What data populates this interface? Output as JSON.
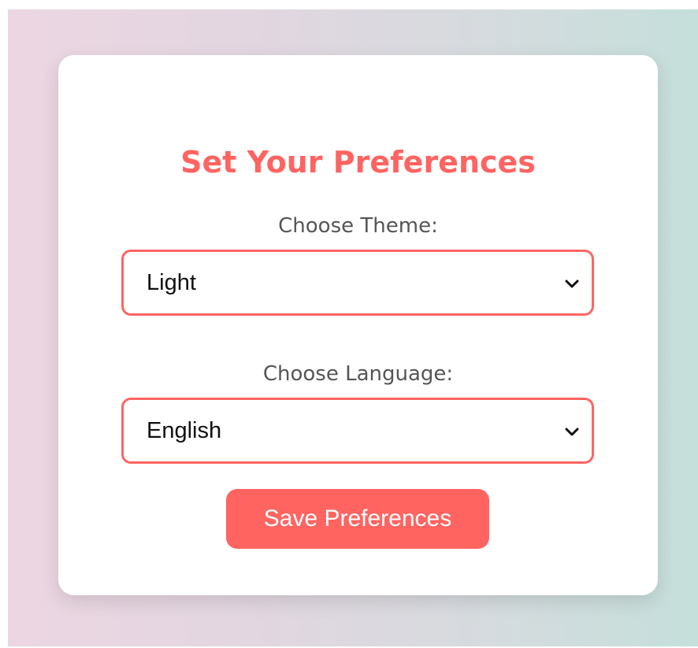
{
  "page": {
    "title": "Set Your Preferences",
    "accent_color": "#ff6461"
  },
  "theme": {
    "label": "Choose Theme:",
    "selected": "Light",
    "icon": "chevron-down-icon"
  },
  "language": {
    "label": "Choose Language:",
    "selected": "English",
    "icon": "chevron-down-icon"
  },
  "actions": {
    "save_label": "Save Preferences"
  }
}
